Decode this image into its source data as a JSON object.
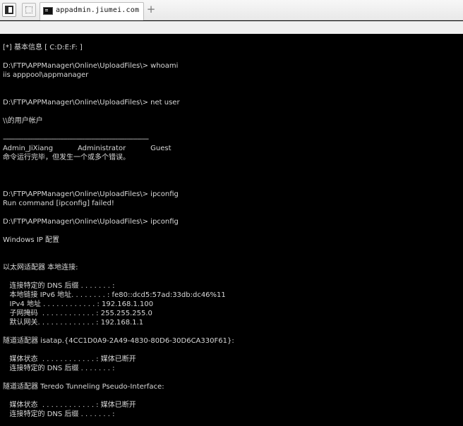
{
  "tabbar": {
    "tab_title": "appadmin.jiumei.com",
    "new_tab_label": "+",
    "icons": [
      "layout-icon",
      "selection-icon",
      "terminal-icon",
      "plus-icon"
    ]
  },
  "console": {
    "lines": [
      "[*] 基本信息 [ C:D:E:F: ]",
      "D:\\FTP\\APPManager\\Online\\UploadFiles\\> whoami",
      "iis apppool\\appmanager",
      "D:\\FTP\\APPManager\\Online\\UploadFiles\\> net user",
      "\\\\的用户帐户",
      "-------------------------------------------------------------------------------",
      "Admin_JiXiang           Administrator           Guest",
      "命令运行完毕，但发生一个或多个错误。",
      "D:\\FTP\\APPManager\\Online\\UploadFiles\\> ipconfig",
      "Run command [ipconfig] failed!",
      "D:\\FTP\\APPManager\\Online\\UploadFiles\\> ipconfig",
      "Windows IP 配置",
      "以太网适配器 本地连接:",
      "   连接特定的 DNS 后缀 . . . . . . . :",
      "   本地链接 IPv6 地址. . . . . . . . : fe80::dcd5:57ad:33db:dc46%11",
      "   IPv4 地址 . . . . . . . . . . . . : 192.168.1.100",
      "   子网掩码  . . . . . . . . . . . . : 255.255.255.0",
      "   默认网关. . . . . . . . . . . . . : 192.168.1.1",
      "隧道适配器 isatap.{4CC1D0A9-2A49-4830-80D6-30D6CA330F61}:",
      "   媒体状态  . . . . . . . . . . . . : 媒体已断开",
      "   连接特定的 DNS 后缀 . . . . . . . :",
      "隧道适配器 Teredo Tunneling Pseudo-Interface:",
      "   媒体状态  . . . . . . . . . . . . : 媒体已断开",
      "   连接特定的 DNS 后缀 . . . . . . . :"
    ]
  }
}
